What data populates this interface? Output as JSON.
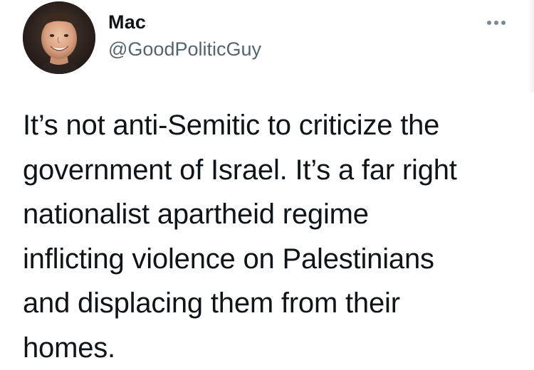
{
  "author": {
    "display_name": "Mac",
    "handle": "@GoodPoliticGuy"
  },
  "tweet": {
    "lines": [
      "It’s not anti-Semitic to criticize the",
      "government of Israel. It’s a far right",
      "nationalist apartheid regime",
      "inflicting violence on Palestinians",
      "and displacing them from their",
      "homes."
    ]
  },
  "icons": {
    "more": "more-options-icon",
    "avatar": "profile-avatar"
  },
  "colors": {
    "text": "#0f1419",
    "secondary_text": "#536471",
    "icon": "#7b8791",
    "background": "#ffffff"
  }
}
